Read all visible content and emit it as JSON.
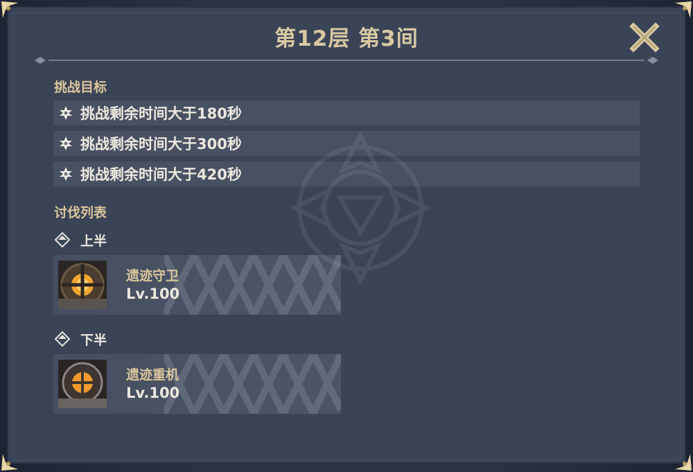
{
  "header": {
    "title": "第12层 第3间"
  },
  "objectives": {
    "heading": "挑战目标",
    "items": [
      {
        "text": "挑战剩余时间大于180秒"
      },
      {
        "text": "挑战剩余时间大于300秒"
      },
      {
        "text": "挑战剩余时间大于420秒"
      }
    ]
  },
  "enemies": {
    "heading": "讨伐列表",
    "halves": [
      {
        "label": "上半",
        "enemy": {
          "name": "遗迹守卫",
          "level": "Lv.100"
        }
      },
      {
        "label": "下半",
        "enemy": {
          "name": "遗迹重机",
          "level": "Lv.100"
        }
      }
    ]
  },
  "icons": {
    "close": "close-icon",
    "objective": "star-icon",
    "half": "diamond-icon"
  },
  "colors": {
    "panel": "#3b4457",
    "title": "#d8c9a3",
    "heading": "#d9c59b",
    "text": "#ece8de"
  }
}
